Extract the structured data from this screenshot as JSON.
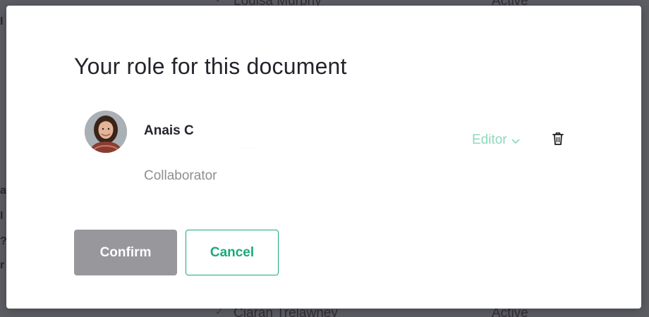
{
  "background": {
    "rows": [
      {
        "name": "Louisa Murphy",
        "status": "Active"
      },
      {
        "name": "Ciaran Trelawney",
        "status": "Active"
      }
    ]
  },
  "modal": {
    "title": "Your role for this document",
    "member": {
      "name": "Anais C",
      "email": "········",
      "label": "Collaborator",
      "role": "Editor"
    },
    "buttons": {
      "confirm": "Confirm",
      "cancel": "Cancel"
    }
  },
  "colors": {
    "accent": "#1ba97a",
    "role_text": "#8fd9bc",
    "confirm_bg": "#97979c",
    "overlay": "#5c5c63"
  },
  "icons": {
    "role_dropdown": "chevron-down-icon",
    "remove_member": "trash-icon",
    "avatar": "user-avatar"
  }
}
